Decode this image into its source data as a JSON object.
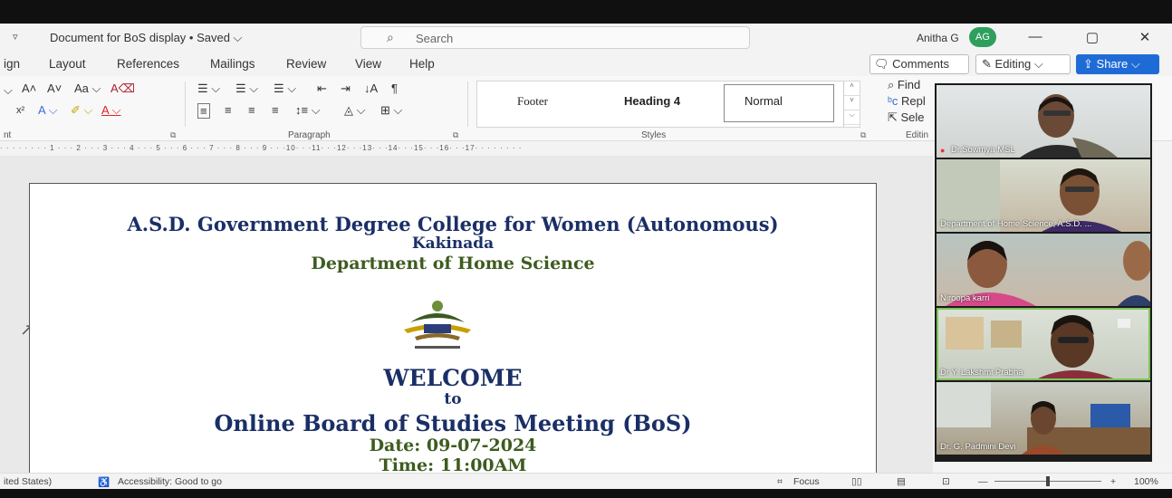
{
  "titlebar": {
    "qa_dropdown": "▿",
    "doc_title": "Document for BoS display • Saved ⌵",
    "search_placeholder": "Search",
    "user_name": "Anitha G",
    "avatar_initials": "AG",
    "minimize": "—",
    "restore": "▢",
    "close": "✕"
  },
  "tabs": [
    {
      "label": "ign"
    },
    {
      "label": "Layout"
    },
    {
      "label": "References"
    },
    {
      "label": "Mailings"
    },
    {
      "label": "Review"
    },
    {
      "label": "View"
    },
    {
      "label": "Help"
    }
  ],
  "actions": {
    "comments": "Comments",
    "editing": "Editing",
    "share": "Share"
  },
  "ribbon": {
    "font_group_label": "nt",
    "paragraph_label": "Paragraph",
    "styles_label": "Styles",
    "editing_label": "Editin",
    "styles": {
      "footer": "Footer",
      "heading4": "Heading 4",
      "normal": "Normal"
    },
    "editing_items": {
      "find": "Find",
      "replace": "Repl",
      "select": "Sele"
    }
  },
  "ruler_text": "· · · · · · · · 1 · · · 2 · · · 3 · · · 4 · · · 5 · · · 6 · · · 7 · · · 8 · · · 9 · · ·10· · ·11· · ·12· · ·13· · ·14· · ·15· · ·16· · ·17· · · · · · · ·",
  "document": {
    "college": "A.S.D. Government Degree College for Women (Autonomous)",
    "city": "Kakinada",
    "department": "Department of Home Science",
    "welcome": "WELCOME",
    "to": "to",
    "meeting": "Online Board of Studies Meeting (BoS)",
    "date": "Date: 09-07-2024",
    "time": "Time: 11:00AM"
  },
  "statusbar": {
    "language": "ited States)",
    "accessibility": "Accessibility: Good to go",
    "focus": "Focus",
    "zoom": "100%",
    "zoom_minus": "—",
    "zoom_plus": "+"
  },
  "participants": [
    {
      "name": "Dr.Sowmya MSL"
    },
    {
      "name": "Department of Home Science, A.S.D. ..."
    },
    {
      "name": "Niroopa karri"
    },
    {
      "name": "Dr Y. Lakshmi Prabha"
    },
    {
      "name": "Dr. G. Padmini Devi"
    }
  ],
  "colors": {
    "accent": "#1f6bd6",
    "avatar": "#2e9f5c",
    "doc_blue": "#1a2f66",
    "doc_green": "#3d5c1f",
    "active_speaker": "#7dc35b"
  }
}
